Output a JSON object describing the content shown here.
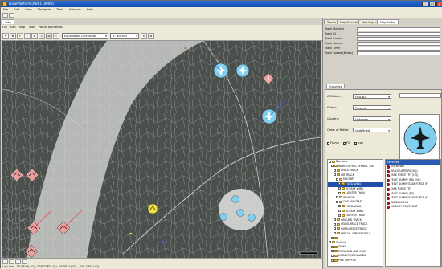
{
  "window": {
    "title": "LocalPlatform [NBC1100001]"
  },
  "menu": [
    "File",
    "Edit",
    "View",
    "Navigate",
    "Tools",
    "Window",
    "Help"
  ],
  "left_tabs": [
    "Tabs"
  ],
  "map_tabs": [
    "File",
    "Edit",
    "Map",
    "Tools",
    "Points of Interest"
  ],
  "map_toolbar": {
    "projection": "Equidistant Cylindrical",
    "scale": "1 : 61,993"
  },
  "right_tabs": [
    "Tracks",
    "Map Overview",
    "Map Layers",
    "Map Editor"
  ],
  "track_fields": [
    {
      "label": "Track Number"
    },
    {
      "label": "Track ID"
    },
    {
      "label": "Track Course"
    },
    {
      "label": "Track Source"
    },
    {
      "label": "Track Time"
    },
    {
      "label": "Track Speed (Knots)"
    }
  ],
  "symbol_tab": "Graphics",
  "props": {
    "affiliation_label": "Affiliation:",
    "affiliation_value": "FRIEND",
    "status_label": "Status:",
    "status_value": "Present",
    "country_label": "Country:",
    "country_value": "Unknown",
    "order_label": "Order of Battle:",
    "order_value": "Undefined",
    "frame_label": "Frame",
    "fill_label": "Fill",
    "icon_label": "Icon"
  },
  "tree_items": [
    {
      "label": "Domains",
      "level": 0
    },
    {
      "label": "WARFIGHTING SYMBOL - UN",
      "level": 1
    },
    {
      "label": "SPACE TRACK",
      "level": 2
    },
    {
      "label": "AIR TRACK",
      "level": 2
    },
    {
      "label": "MILITARY",
      "level": 3
    },
    {
      "label": "FIXED WING",
      "level": 4,
      "selected": true
    },
    {
      "label": "ROTARY WING",
      "level": 4
    },
    {
      "label": "LIGHTER THAN",
      "level": 4
    },
    {
      "label": "WEAPON",
      "level": 3
    },
    {
      "label": "CIVIL AIRCRAFT",
      "level": 3
    },
    {
      "label": "FIXED WING",
      "level": 4
    },
    {
      "label": "ROTARY WING",
      "level": 4
    },
    {
      "label": "LIGHTER THAN",
      "level": 4
    },
    {
      "label": "GROUND TRACK",
      "level": 2
    },
    {
      "label": "SEA SURFACE TRACK",
      "level": 2
    },
    {
      "label": "SUBSURFACE TRACK",
      "level": 2
    },
    {
      "label": "SPECIAL OPERATIONS F",
      "level": 2
    },
    {
      "label": "",
      "level": 1
    },
    {
      "label": "Tactical",
      "level": 0
    },
    {
      "label": "TASKS",
      "level": 1
    },
    {
      "label": "COMMAND AND CONT",
      "level": 1
    },
    {
      "label": "MOBILITY/SURVIVABIL",
      "level": 1
    },
    {
      "label": "FIRE SUPPORT",
      "level": 1
    }
  ],
  "favorites": {
    "header": "Favorites",
    "items": [
      "UNKNOWN",
      "HEADQUARTERS (HQ)",
      "TASK FORCE (TF) (HQ)",
      "FEINT DUMMY (FD) (HQ)",
      "FEINT DUMMY/TASK FORCE (F",
      "TASK FORCE (TF)",
      "FEINT DUMMY (FD)",
      "FEINT DUMMY/TASK FORCE (F",
      "INSTALLATION",
      "MOBILITY EQUIPMENT"
    ]
  },
  "status": {
    "coords": "Lat/ Lon: -25.0548(-0\")  , 028.2282(-0\")   -25.0511(-0\")  , 028.2357(-0\")"
  },
  "colors": {
    "friend": "#7fd0f0",
    "hostile": "#e8a0a0",
    "unknown": "#f0e040",
    "selection": "#1f4fa8"
  }
}
